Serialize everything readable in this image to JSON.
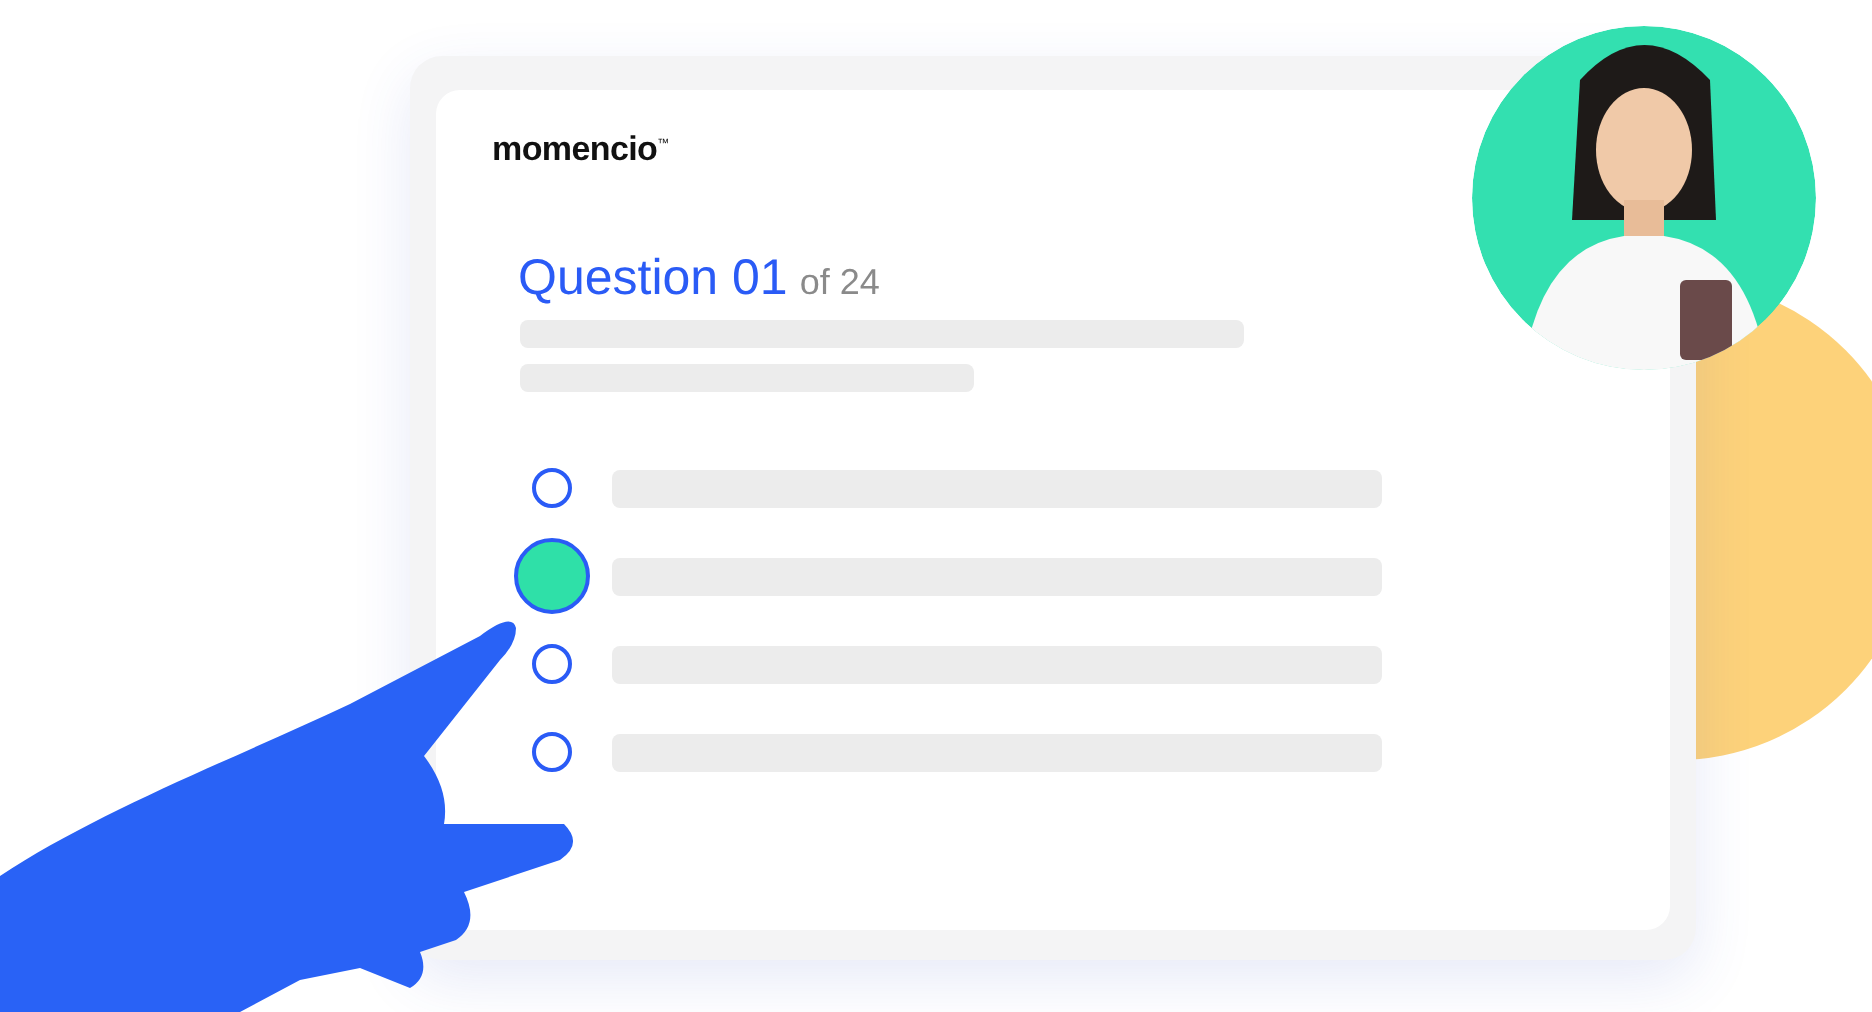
{
  "logo": {
    "text": "momencio",
    "mark": "™"
  },
  "question": {
    "title": "Question 01",
    "count": "of 24"
  },
  "options": [
    {
      "selected": false
    },
    {
      "selected": true
    },
    {
      "selected": false
    },
    {
      "selected": false
    }
  ]
}
